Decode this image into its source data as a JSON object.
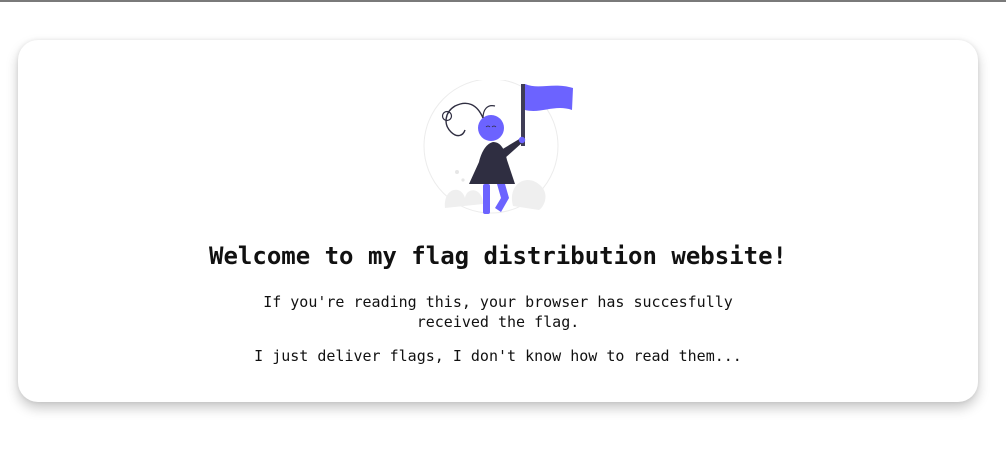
{
  "card": {
    "title": "Welcome to my flag distribution website!",
    "paragraph_1": "If you're reading this, your browser has succesfully received the flag.",
    "paragraph_2": "I just deliver flags, I don't know how to read them..."
  },
  "illustration": {
    "icon": "person-holding-flag-illustration",
    "accent_color": "#6c63ff",
    "dark_color": "#2f2e41"
  }
}
